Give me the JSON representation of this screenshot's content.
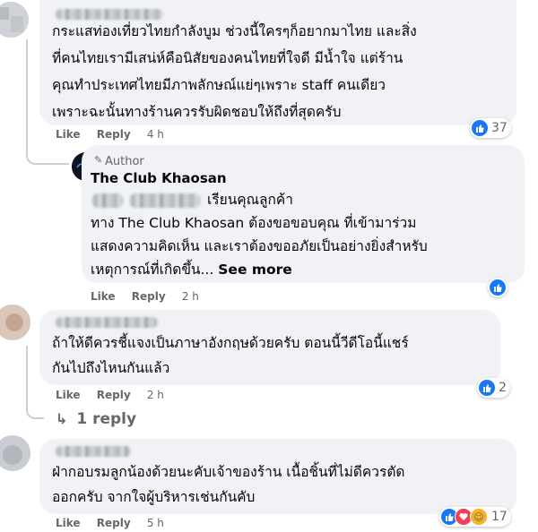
{
  "comments": [
    {
      "lines": [
        "กระแสท่องเที่ยวไทยกำลังบูม ช่วงนี้ใครๆก็อยากมาไทย และสิ่ง",
        "ที่คนไทยเรามีเสน่ห์คือนิสัยของคนไทยที่ใจดี มีน้ำใจ แต่ร้าน",
        "คุณทำประเทศไทยมีภาพลักษณ์แย่ๆเพราะ staff คนเดียว",
        "เพราะฉะนั้นทางร้านควรรับผิดชอบให้ถึงที่สุดครับ"
      ],
      "like": "Like",
      "reply": "Reply",
      "time": "4 h",
      "reactions": "37"
    },
    {
      "lines": [
        "ถ้าให้ดีควรชี้แจงเป็นภาษาอังกฤษด้วยครับ ตอนนี้วีดีโอนี้แชร์",
        "กันไปถึงไหนกันแล้ว"
      ],
      "like": "Like",
      "reply": "Reply",
      "time": "2 h",
      "reactions": "2",
      "replies_link": "1 reply"
    },
    {
      "lines": [
        "ฝ่ากอบรมลูกน้องด้วยนะคับเจ้าของร้าน เนื้อชิ้นที่ไม่ดีควรตัด",
        "ออกครับ จากใจผู้บริหารเช่นกันคับ"
      ],
      "like": "Like",
      "reply": "Reply",
      "time": "5 h",
      "reactions": "17"
    }
  ],
  "author_reply": {
    "badge": "Author",
    "name": "The Club Khaosan",
    "salutation": "เรียนคุณลูกค้า",
    "lines": [
      "ทาง The Club Khaosan ต้องขอขอบคุณ ที่เข้ามาร่วม",
      "แสดงความคิดเห็น และเราต้องขออภัยเป็นอย่างยิ่งสำหรับ",
      "เหตุการณ์ที่เกิดขึ้น..."
    ],
    "see_more": "See more",
    "like": "Like",
    "reply": "Reply",
    "time": "2 h"
  },
  "icons": {
    "like": "like-icon",
    "heart": "love-icon",
    "care": "care-icon",
    "pencil": "pencil-icon",
    "reply_arrow": "reply-arrow-icon"
  },
  "colors": {
    "facebook_blue": "#1877f2",
    "bubble": "#f0f2f5",
    "meta_text": "#65676b",
    "love": "#f33e58",
    "care": "#f7b125"
  }
}
